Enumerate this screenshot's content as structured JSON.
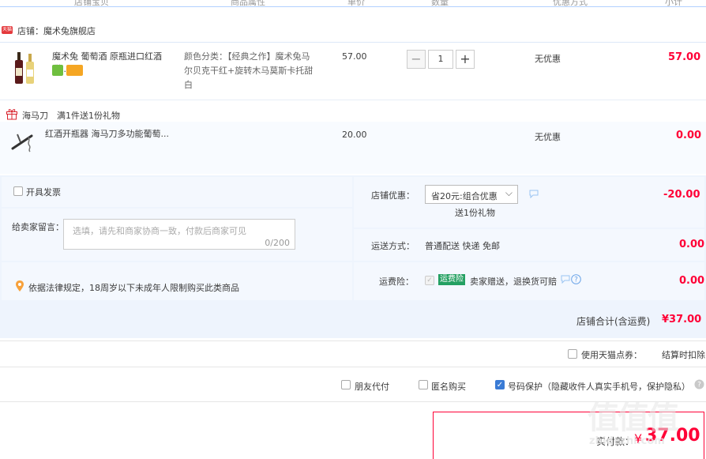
{
  "header": {
    "columns": [
      "店铺宝贝",
      "商品属性",
      "单价",
      "数量",
      "优惠方式",
      "小计"
    ]
  },
  "store": {
    "badge": "天猫",
    "name": "店铺：魔术兔旗舰店"
  },
  "item1": {
    "title": "魔术兔 葡萄酒 原瓶进口红酒甜...",
    "prop_label": "颜色分类：",
    "prop_line1": "【经典之作】魔术兔马",
    "prop_line2": "尔贝克干红+旋转木马莫斯卡托甜",
    "prop_line3": "白",
    "price": "57.00",
    "qty_minus": "−",
    "qty": "1",
    "qty_plus": "+",
    "discount": "无优惠",
    "subtotal": "57.00"
  },
  "gift": {
    "label": "海马刀",
    "rule": "满1件送1份礼物"
  },
  "item2": {
    "title": "红酒开瓶器 海马刀多功能葡萄...",
    "price": "20.00",
    "discount": "无优惠",
    "subtotal": "0.00"
  },
  "invoice": {
    "label": "开具发票"
  },
  "message": {
    "label": "给卖家留言：",
    "placeholder": "选填，请先和商家协商一致，付款后商家可见",
    "counter": "0/200"
  },
  "legal": {
    "text": "依据法律规定，18周岁以下未成年人限制购买此类商品"
  },
  "store_discount": {
    "label": "店铺优惠：",
    "selected": "省20元:组合优惠",
    "sub": "送1份礼物",
    "amount": "-20.00"
  },
  "shipping": {
    "label": "运送方式：",
    "value": "普通配送 快递 免邮",
    "amount": "0.00"
  },
  "insurance": {
    "label": "运费险：",
    "tag": "运费险",
    "text": "卖家赠送，退换货可赔",
    "amount": "0.00"
  },
  "store_total": {
    "label": "店铺合计(含运费)",
    "value": "¥37.00"
  },
  "points": {
    "label": "使用天猫点券：",
    "text": "结算时扣除"
  },
  "options": {
    "friend_pay": "朋友代付",
    "anonymous": "匿名购买",
    "privacy": "号码保护（隐藏收件人真实手机号，保护隐私）"
  },
  "payable": {
    "label": "实付款：",
    "currency": "¥",
    "value": "37.00"
  },
  "watermark": {
    "big": "值值值",
    "small": "zhidezhi.com"
  },
  "colors": {
    "accent": "#ff0036",
    "blue": "#3a7bd5",
    "panel": "#eef4fd"
  }
}
